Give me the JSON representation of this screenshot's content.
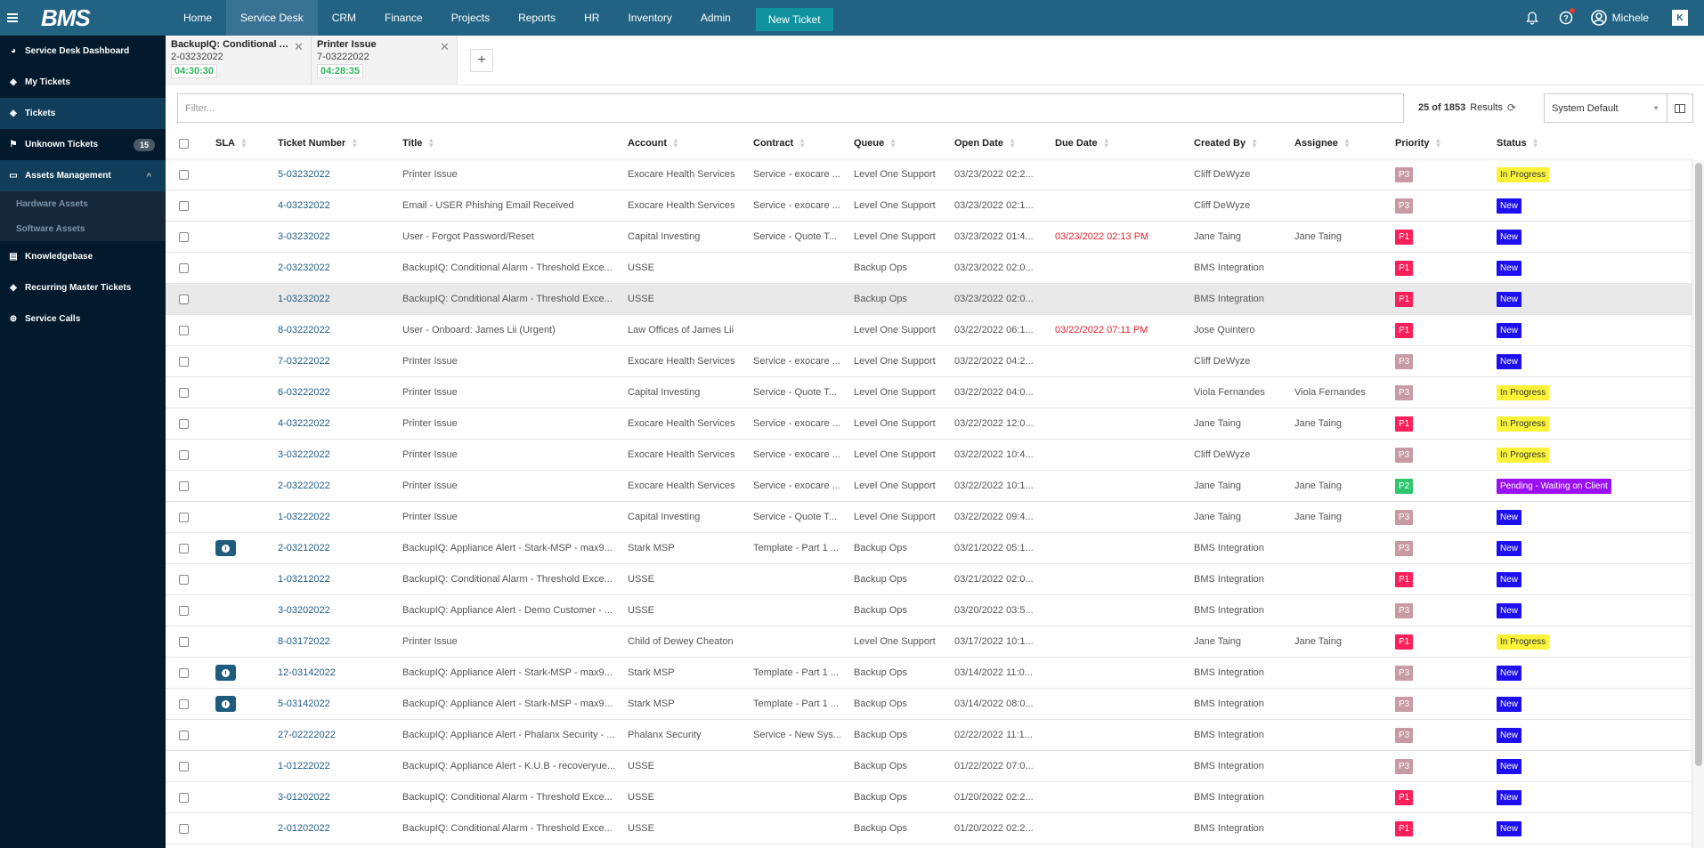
{
  "topbar": {
    "logo": "BMS",
    "nav": [
      "Home",
      "Service Desk",
      "CRM",
      "Finance",
      "Projects",
      "Reports",
      "HR",
      "Inventory",
      "Admin"
    ],
    "active_nav": "Service Desk",
    "new_ticket_label": "New Ticket",
    "user_name": "Michele",
    "k_logo": "K"
  },
  "sidebar": {
    "items": [
      {
        "label": "Service Desk Dashboard",
        "icon": "dashboard-icon"
      },
      {
        "label": "My Tickets",
        "icon": "ticket-icon"
      },
      {
        "label": "Tickets",
        "icon": "ticket-icon"
      },
      {
        "label": "Unknown Tickets",
        "icon": "flag-icon",
        "badge": "15"
      },
      {
        "label": "Assets Management",
        "icon": "laptop-icon"
      },
      {
        "label": "Knowledgebase",
        "icon": "book-icon"
      },
      {
        "label": "Recurring Master Tickets",
        "icon": "ticket-icon"
      },
      {
        "label": "Service Calls",
        "icon": "lifebuoy-icon"
      }
    ],
    "sub_items": [
      "Hardware Assets",
      "Software Assets"
    ]
  },
  "tabs": [
    {
      "title": "BackupIQ: Conditional Al...",
      "number": "2-03232022",
      "timer": "04:30:30"
    },
    {
      "title": "Printer Issue",
      "number": "7-03222022",
      "timer": "04:28:35"
    }
  ],
  "toolbar": {
    "filter_placeholder": "Filter...",
    "results_count": "25 of 1853",
    "results_label": "Results",
    "view_select": "System Default"
  },
  "table": {
    "columns": [
      "SLA",
      "Ticket Number",
      "Title",
      "Account",
      "Contract",
      "Queue",
      "Open Date",
      "Due Date",
      "Created By",
      "Assignee",
      "Priority",
      "Status"
    ],
    "priority_colors": {
      "P1": "#ff1f5a",
      "P2": "#2ec76d",
      "P3": "#c89ba4"
    },
    "status_colors": {
      "New": {
        "bg": "#1d0ff0",
        "fg": "#ffffff"
      },
      "In Progress": {
        "bg": "#fbf33a",
        "fg": "#333333"
      },
      "Pending - Waiting on Client": {
        "bg": "#9b10f0",
        "fg": "#ffffff"
      }
    },
    "rows": [
      {
        "sla": false,
        "number": "5-03232022",
        "title": "Printer Issue",
        "account": "Exocare Health Services",
        "contract": "Service - exocare ...",
        "queue": "Level One Support",
        "open": "03/23/2022 02:2...",
        "due": "",
        "created": "Cliff DeWyze",
        "assignee": "",
        "priority": "P3",
        "status": "In Progress"
      },
      {
        "sla": false,
        "number": "4-03232022",
        "title": "Email - USER Phishing Email Received",
        "account": "Exocare Health Services",
        "contract": "Service - exocare ...",
        "queue": "Level One Support",
        "open": "03/23/2022 02:1...",
        "due": "",
        "created": "Cliff DeWyze",
        "assignee": "",
        "priority": "P3",
        "status": "New"
      },
      {
        "sla": false,
        "number": "3-03232022",
        "title": "User - Forgot Password/Reset",
        "account": "Capital Investing",
        "contract": "Service - Quote T...",
        "queue": "Level One Support",
        "open": "03/23/2022 01:4...",
        "due": "03/23/2022 02:13 PM",
        "created": "Jane Taing",
        "assignee": "Jane Taing",
        "priority": "P1",
        "status": "New"
      },
      {
        "sla": false,
        "number": "2-03232022",
        "title": "BackupIQ: Conditional Alarm - Threshold Exce...",
        "account": "USSE",
        "contract": "",
        "queue": "Backup Ops",
        "open": "03/23/2022 02:0...",
        "due": "",
        "created": "BMS Integration",
        "assignee": "",
        "priority": "P1",
        "status": "New"
      },
      {
        "sla": false,
        "number": "1-03232022",
        "title": "BackupIQ: Conditional Alarm - Threshold Exce...",
        "account": "USSE",
        "contract": "",
        "queue": "Backup Ops",
        "open": "03/23/2022 02:0...",
        "due": "",
        "created": "BMS Integration",
        "assignee": "",
        "priority": "P1",
        "status": "New",
        "hover": true
      },
      {
        "sla": false,
        "number": "8-03222022",
        "title": "User - Onboard: James Lii (Urgent)",
        "account": "Law Offices of James Lii",
        "contract": "",
        "queue": "Level One Support",
        "open": "03/22/2022 06:1...",
        "due": "03/22/2022 07:11 PM",
        "created": "Jose Quintero",
        "assignee": "",
        "priority": "P1",
        "status": "New"
      },
      {
        "sla": false,
        "number": "7-03222022",
        "title": "Printer Issue",
        "account": "Exocare Health Services",
        "contract": "Service - exocare ...",
        "queue": "Level One Support",
        "open": "03/22/2022 04:2...",
        "due": "",
        "created": "Cliff DeWyze",
        "assignee": "",
        "priority": "P3",
        "status": "New"
      },
      {
        "sla": false,
        "number": "6-03222022",
        "title": "Printer Issue",
        "account": "Capital Investing",
        "contract": "Service - Quote T...",
        "queue": "Level One Support",
        "open": "03/22/2022 04:0...",
        "due": "",
        "created": "Viola Fernandes",
        "assignee": "Viola Fernandes",
        "priority": "P3",
        "status": "In Progress"
      },
      {
        "sla": false,
        "number": "4-03222022",
        "title": "Printer Issue",
        "account": "Exocare Health Services",
        "contract": "Service - exocare ...",
        "queue": "Level One Support",
        "open": "03/22/2022 12:0...",
        "due": "",
        "created": "Jane Taing",
        "assignee": "Jane Taing",
        "priority": "P1",
        "status": "In Progress"
      },
      {
        "sla": false,
        "number": "3-03222022",
        "title": "Printer Issue",
        "account": "Exocare Health Services",
        "contract": "Service - exocare ...",
        "queue": "Level One Support",
        "open": "03/22/2022 10:4...",
        "due": "",
        "created": "Cliff DeWyze",
        "assignee": "",
        "priority": "P3",
        "status": "In Progress"
      },
      {
        "sla": false,
        "number": "2-03222022",
        "title": "Printer Issue",
        "account": "Exocare Health Services",
        "contract": "Service - exocare ...",
        "queue": "Level One Support",
        "open": "03/22/2022 10:1...",
        "due": "",
        "created": "Jane Taing",
        "assignee": "Jane Taing",
        "priority": "P2",
        "status": "Pending - Waiting on Client"
      },
      {
        "sla": false,
        "number": "1-03222022",
        "title": "Printer Issue",
        "account": "Capital Investing",
        "contract": "Service - Quote T...",
        "queue": "Level One Support",
        "open": "03/22/2022 09:4...",
        "due": "",
        "created": "Jane Taing",
        "assignee": "Jane Taing",
        "priority": "P3",
        "status": "New"
      },
      {
        "sla": true,
        "number": "2-03212022",
        "title": "BackupIQ: Appliance Alert - Stark-MSP - max9...",
        "account": "Stark MSP",
        "contract": "Template - Part 1 ...",
        "queue": "Backup Ops",
        "open": "03/21/2022 05:1...",
        "due": "",
        "created": "BMS Integration",
        "assignee": "",
        "priority": "P3",
        "status": "New"
      },
      {
        "sla": false,
        "number": "1-03212022",
        "title": "BackupIQ: Conditional Alarm - Threshold Exce...",
        "account": "USSE",
        "contract": "",
        "queue": "Backup Ops",
        "open": "03/21/2022 02:0...",
        "due": "",
        "created": "BMS Integration",
        "assignee": "",
        "priority": "P1",
        "status": "New"
      },
      {
        "sla": false,
        "number": "3-03202022",
        "title": "BackupIQ: Appliance Alert - Demo Customer - ...",
        "account": "USSE",
        "contract": "",
        "queue": "Backup Ops",
        "open": "03/20/2022 03:5...",
        "due": "",
        "created": "BMS Integration",
        "assignee": "",
        "priority": "P3",
        "status": "New"
      },
      {
        "sla": false,
        "number": "8-03172022",
        "title": "Printer Issue",
        "account": "Child of Dewey Cheaton",
        "contract": "",
        "queue": "Level One Support",
        "open": "03/17/2022 10:1...",
        "due": "",
        "created": "Jane Taing",
        "assignee": "Jane Taing",
        "priority": "P1",
        "status": "In Progress"
      },
      {
        "sla": true,
        "number": "12-03142022",
        "title": "BackupIQ: Appliance Alert - Stark-MSP - max9...",
        "account": "Stark MSP",
        "contract": "Template - Part 1 ...",
        "queue": "Backup Ops",
        "open": "03/14/2022 11:0...",
        "due": "",
        "created": "BMS Integration",
        "assignee": "",
        "priority": "P3",
        "status": "New"
      },
      {
        "sla": true,
        "number": "5-03142022",
        "title": "BackupIQ: Appliance Alert - Stark-MSP - max9...",
        "account": "Stark MSP",
        "contract": "Template - Part 1 ...",
        "queue": "Backup Ops",
        "open": "03/14/2022 08:0...",
        "due": "",
        "created": "BMS Integration",
        "assignee": "",
        "priority": "P3",
        "status": "New"
      },
      {
        "sla": false,
        "number": "27-02222022",
        "title": "BackupIQ: Appliance Alert - Phalanx Security - ...",
        "account": "Phalanx Security",
        "contract": "Service - New Sys...",
        "queue": "Backup Ops",
        "open": "02/22/2022 11:1...",
        "due": "",
        "created": "BMS Integration",
        "assignee": "",
        "priority": "P3",
        "status": "New"
      },
      {
        "sla": false,
        "number": "1-01222022",
        "title": "BackupIQ: Appliance Alert - K.U.B - recoveryue...",
        "account": "USSE",
        "contract": "",
        "queue": "Backup Ops",
        "open": "01/22/2022 07:0...",
        "due": "",
        "created": "BMS Integration",
        "assignee": "",
        "priority": "P3",
        "status": "New"
      },
      {
        "sla": false,
        "number": "3-01202022",
        "title": "BackupIQ: Conditional Alarm - Threshold Exce...",
        "account": "USSE",
        "contract": "",
        "queue": "Backup Ops",
        "open": "01/20/2022 02:2...",
        "due": "",
        "created": "BMS Integration",
        "assignee": "",
        "priority": "P1",
        "status": "New"
      },
      {
        "sla": false,
        "number": "2-01202022",
        "title": "BackupIQ: Conditional Alarm - Threshold Exce...",
        "account": "USSE",
        "contract": "",
        "queue": "Backup Ops",
        "open": "01/20/2022 02:2...",
        "due": "",
        "created": "BMS Integration",
        "assignee": "",
        "priority": "P1",
        "status": "New"
      }
    ]
  }
}
